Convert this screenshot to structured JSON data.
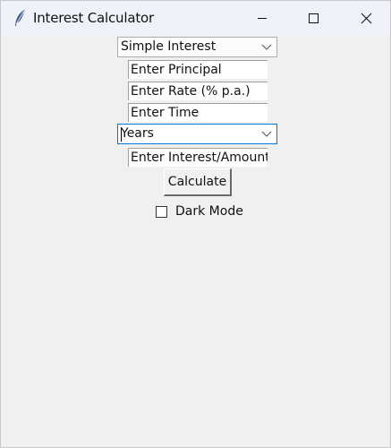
{
  "window": {
    "title": "Interest Calculator",
    "app_icon": "feather-icon",
    "controls": [
      "minimize-icon",
      "maximize-icon",
      "close-icon"
    ]
  },
  "form": {
    "interest_type": "Simple Interest",
    "principal_value": "Enter Principal",
    "rate_value": "Enter Rate (% p.a.)",
    "time_value": "Enter Time",
    "time_unit": "Years",
    "interest_value": "Enter Interest/Amount",
    "calculate_label": "Calculate",
    "dark_mode_label": "Dark Mode",
    "dark_mode_checked": false
  },
  "colors": {
    "background": "#f0f0f0",
    "titlebar": "#eff3f9",
    "focus_border": "#0078d7"
  }
}
